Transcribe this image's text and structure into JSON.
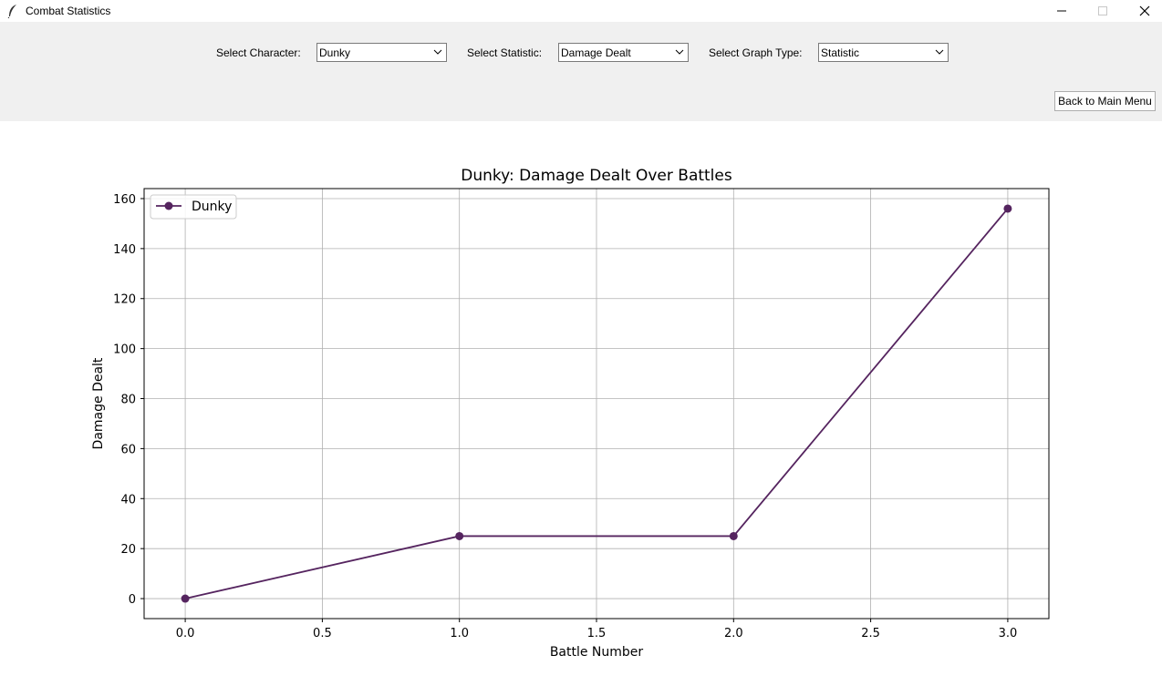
{
  "window": {
    "title": "Combat Statistics",
    "icon": "feather-icon"
  },
  "controls": {
    "character_label": "Select Character:",
    "character_value": "Dunky",
    "statistic_label": "Select Statistic:",
    "statistic_value": "Damage Dealt",
    "graph_type_label": "Select Graph Type:",
    "graph_type_value": "Statistic",
    "back_button": "Back to Main Menu"
  },
  "chart_data": {
    "type": "line",
    "title": "Dunky: Damage Dealt Over Battles",
    "xlabel": "Battle Number",
    "ylabel": "Damage Dealt",
    "xlim": [
      -0.15,
      3.15
    ],
    "ylim": [
      -8,
      164
    ],
    "xticks": [
      0.0,
      0.5,
      1.0,
      1.5,
      2.0,
      2.5,
      3.0
    ],
    "yticks": [
      0,
      20,
      40,
      60,
      80,
      100,
      120,
      140,
      160
    ],
    "grid": true,
    "legend_position": "upper-left",
    "series": [
      {
        "name": "Dunky",
        "color": "#55245f",
        "marker": "circle",
        "x": [
          0,
          1,
          2,
          3
        ],
        "y": [
          0,
          25,
          25,
          156
        ]
      }
    ]
  }
}
